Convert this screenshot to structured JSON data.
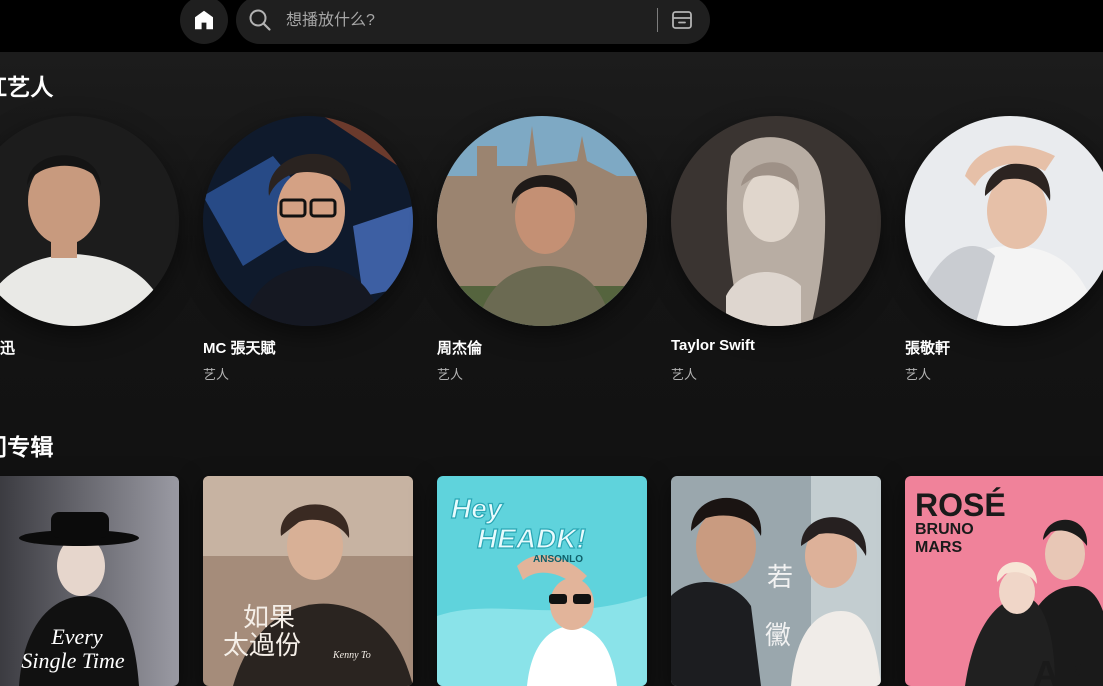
{
  "search": {
    "placeholder": "想播放什么?"
  },
  "sections": [
    {
      "title": "红艺人",
      "cards": [
        {
          "name": "迅",
          "subtitle": ""
        },
        {
          "name": "MC 張天賦",
          "subtitle": "艺人"
        },
        {
          "name": "周杰倫",
          "subtitle": "艺人"
        },
        {
          "name": "Taylor Swift",
          "subtitle": "艺人"
        },
        {
          "name": "張敬軒",
          "subtitle": "艺人"
        }
      ]
    },
    {
      "title": "门专辑",
      "covers": [
        {
          "line1": "Every",
          "line2": "Single Time"
        },
        {
          "line1": "如果",
          "line2": "太過份",
          "small": "Kenny To"
        },
        {
          "line1": "Hey",
          "line2": "HEADK!",
          "small": "ANSONLO"
        },
        {
          "line1": "若",
          "line2": "黴"
        },
        {
          "line1": "ROSÉ",
          "line2": "BRUNO",
          "line3": "MARS",
          "line4": "APT"
        }
      ]
    }
  ],
  "colors": {
    "background": "#121212",
    "topbar": "#000000",
    "control": "#1f1f1f",
    "muted_text": "#b3b3b3"
  }
}
